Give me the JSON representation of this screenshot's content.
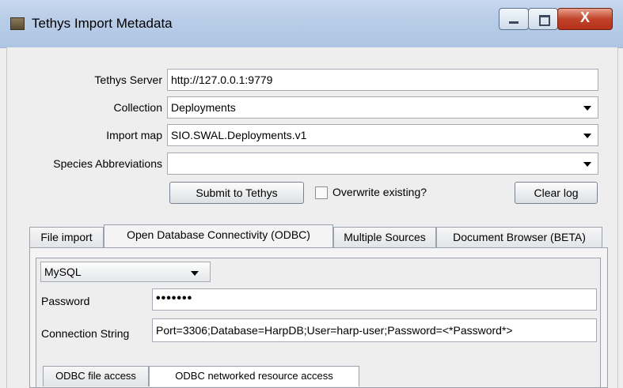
{
  "window": {
    "title": "Tethys Import Metadata",
    "close_glyph": "X"
  },
  "form": {
    "server_label": "Tethys Server",
    "server_value": "http://127.0.0.1:9779",
    "collection_label": "Collection",
    "collection_value": "Deployments",
    "import_map_label": "Import map",
    "import_map_value": "SIO.SWAL.Deployments.v1",
    "species_label": "Species Abbreviations",
    "species_value": "",
    "submit_label": "Submit to Tethys",
    "overwrite_label": "Overwrite existing?",
    "overwrite_checked": false,
    "clear_log_label": "Clear log"
  },
  "tabs": [
    {
      "label": "File import"
    },
    {
      "label": "Open Database Connectivity (ODBC)"
    },
    {
      "label": "Multiple Sources"
    },
    {
      "label": "Document Browser (BETA)"
    }
  ],
  "active_tab_index": 1,
  "odbc": {
    "driver_value": "MySQL",
    "password_label": "Password",
    "password_value": "•••••••",
    "connection_label": "Connection String",
    "connection_value": "Port=3306;Database=HarpDB;User=harp-user;Password=<*Password*>",
    "subtabs": [
      {
        "label": "ODBC file access"
      },
      {
        "label": "ODBC networked resource access"
      }
    ],
    "active_subtab_index": 1
  }
}
